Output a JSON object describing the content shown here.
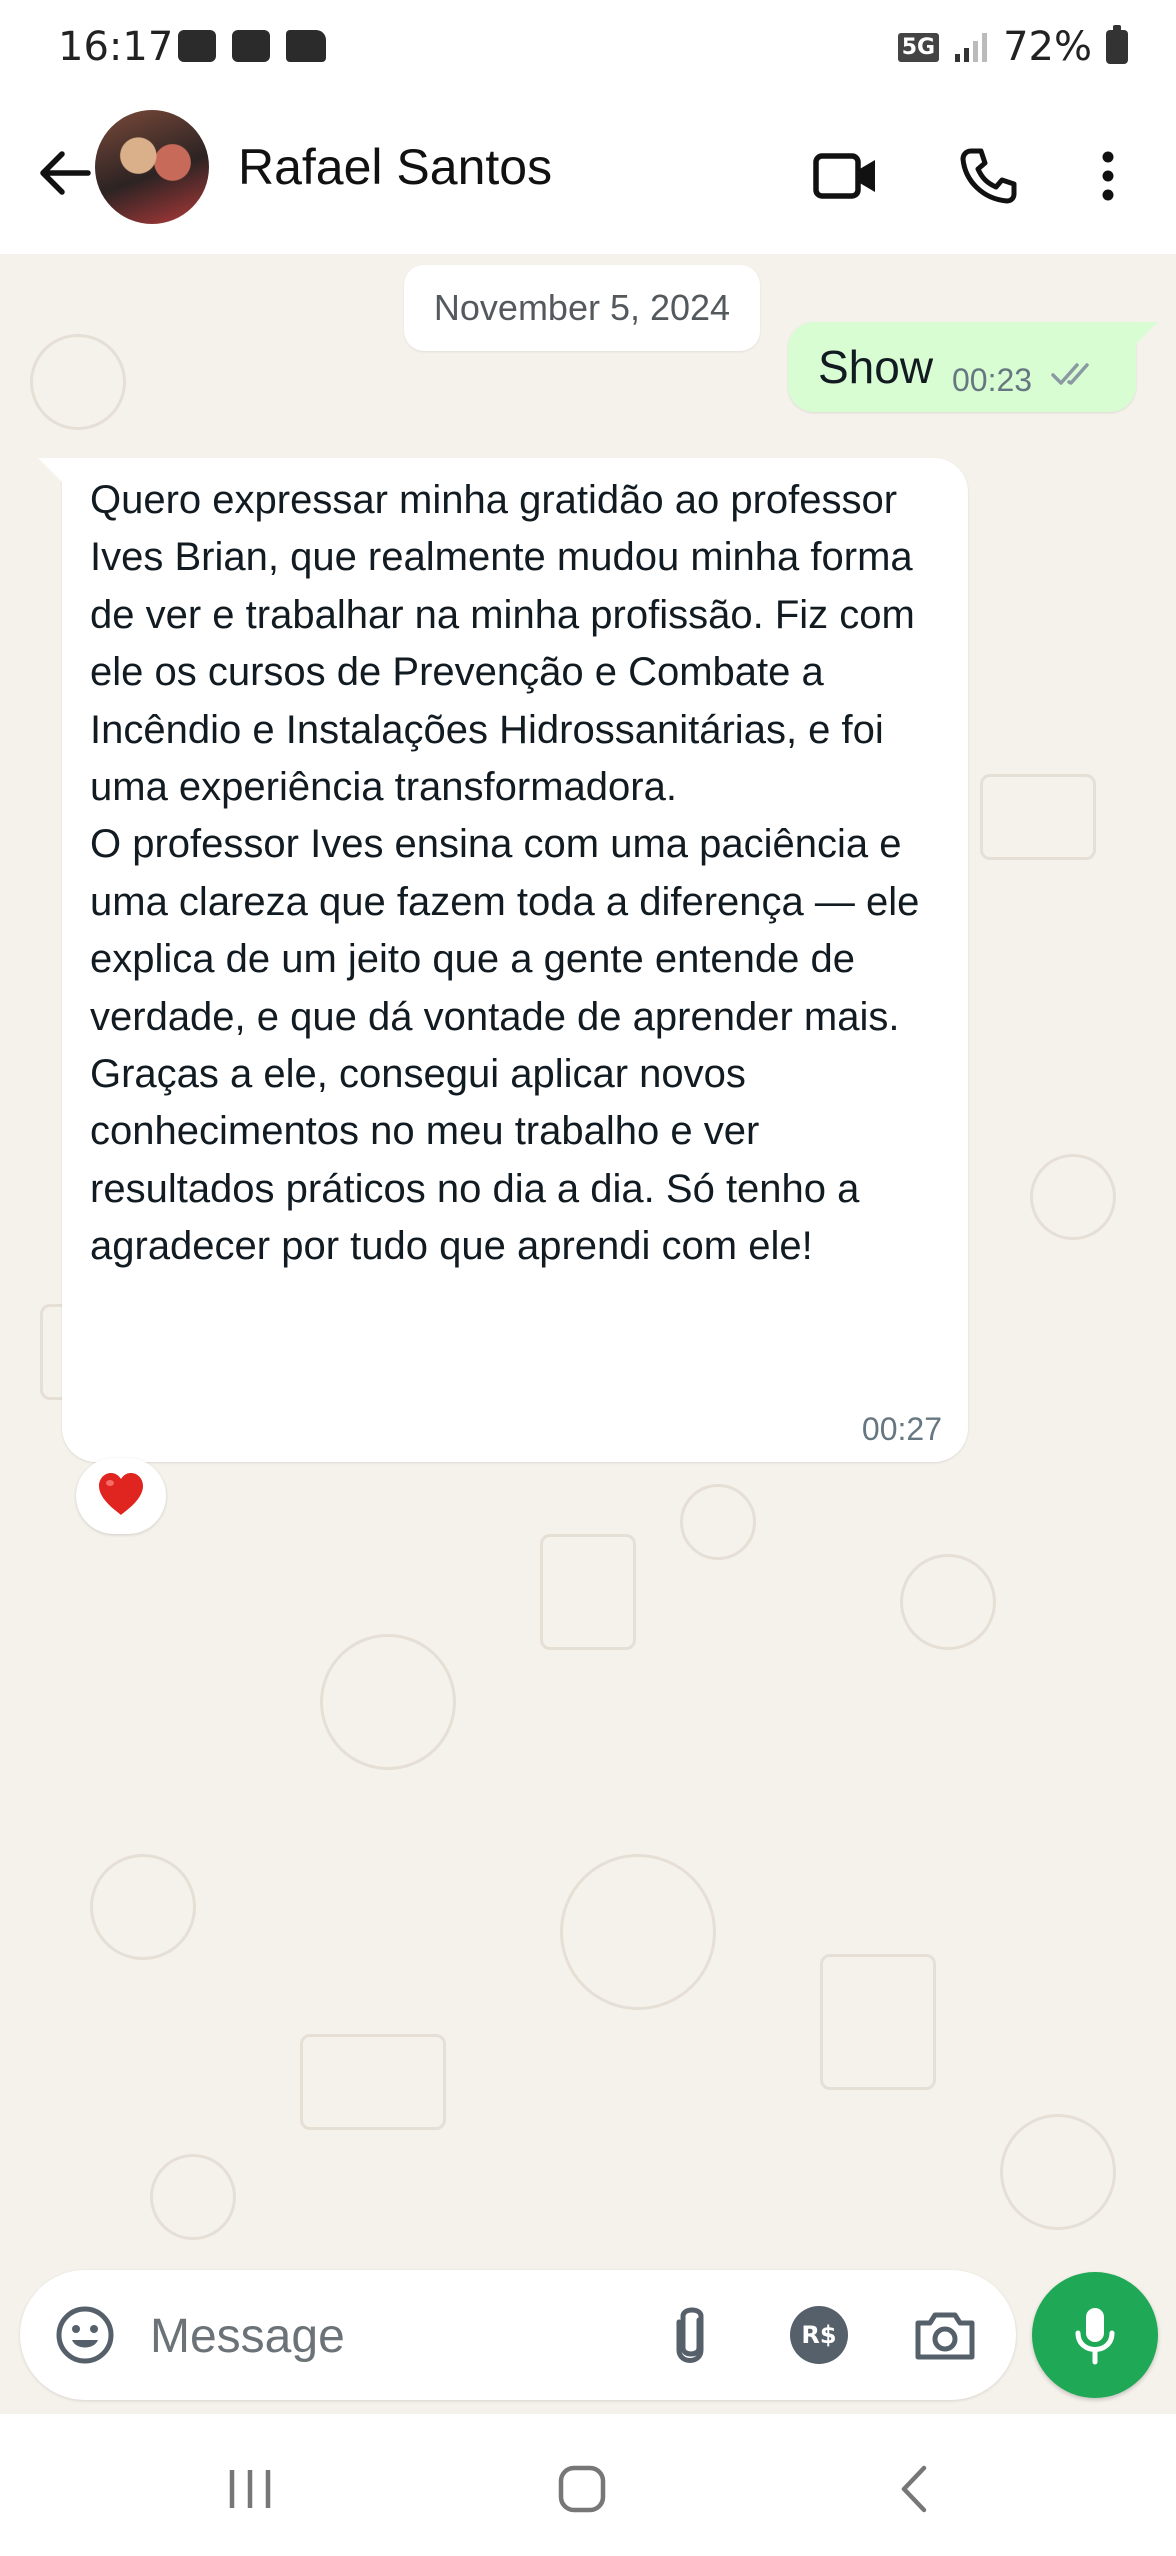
{
  "status_bar": {
    "time": "16:17",
    "network": "5G",
    "battery": "72%",
    "left_icons": [
      "voicemail-icon",
      "clock-icon",
      "folder-icon"
    ],
    "right_icons": [
      "signal-icon",
      "battery-icon"
    ]
  },
  "header": {
    "contact_name": "Rafael Santos",
    "icons": [
      "back-arrow-icon",
      "avatar",
      "video-call-icon",
      "phone-call-icon",
      "more-vert-icon"
    ]
  },
  "chat": {
    "date_chip": "November 5, 2024",
    "outgoing": {
      "text": "Show",
      "time": "00:23",
      "status": "read"
    },
    "incoming": {
      "text": "Quero expressar minha gratidão ao professor Ives Brian, que realmente mudou minha forma de ver e trabalhar na minha profissão. Fiz com ele os cursos de Prevenção e Combate a Incêndio e Instalações Hidrossanitárias, e foi uma experiência transformadora.\nO professor Ives ensina com uma paciência e uma clareza que fazem toda a diferença — ele explica de um jeito que a gente entende de verdade, e que dá vontade de aprender mais. Graças a ele, consegui aplicar novos conhecimentos no meu trabalho e ver resultados práticos no dia a dia. Só tenho a agradecer por tudo que aprendi com ele!",
      "time": "00:27",
      "reaction": "❤️"
    }
  },
  "composer": {
    "placeholder": "Message",
    "payment_badge": "R$",
    "icons": [
      "emoji-icon",
      "attach-icon",
      "payment-icon",
      "camera-icon",
      "mic-icon"
    ]
  },
  "nav_bar": {
    "icons": [
      "recents-icon",
      "home-icon",
      "back-icon"
    ]
  },
  "colors": {
    "outgoing_bubble": "#d9fdd3",
    "incoming_bubble": "#ffffff",
    "chat_background": "#f5f1eb",
    "accent_green": "#1fa855",
    "read_ticks": "#8a9aa3"
  }
}
